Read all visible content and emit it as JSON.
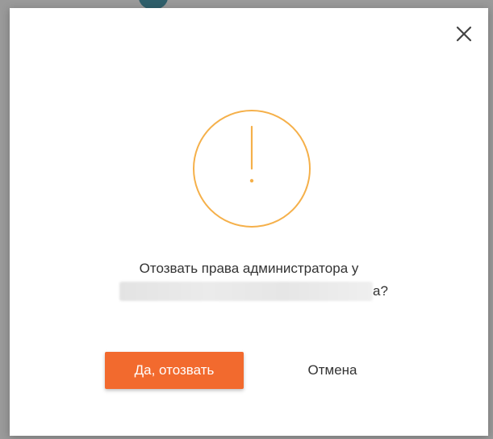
{
  "dialog": {
    "message_line1": "Отозвать права администратора у",
    "message_name_suffix": "а?",
    "confirm_label": "Да, отозвать",
    "cancel_label": "Отмена",
    "close_icon": "close-icon",
    "warning_icon": "warning-icon"
  },
  "colors": {
    "accent": "#f26a2e",
    "warning": "#f5b04a",
    "overlay": "#9a9a9a",
    "text": "#333333"
  }
}
